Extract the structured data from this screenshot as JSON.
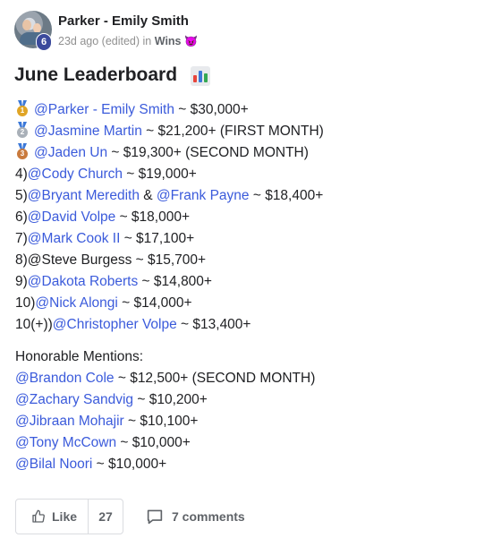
{
  "post": {
    "author": "Parker - Emily Smith",
    "level": "6",
    "time": "23d ago (edited)",
    "in_label": "in",
    "category": "Wins",
    "category_emoji": "😈",
    "title": "June Leaderboard",
    "title_emoji": "chart-icon"
  },
  "leaderboard": [
    {
      "prefix": "",
      "medal": "1",
      "names": [
        "@Parker - Emily Smith"
      ],
      "joiner": "",
      "suffix": " ~ $30,000+"
    },
    {
      "prefix": "",
      "medal": "2",
      "names": [
        "@Jasmine Martin"
      ],
      "joiner": "",
      "suffix": " ~ $21,200+ (FIRST MONTH)"
    },
    {
      "prefix": "",
      "medal": "3",
      "names": [
        "@Jaden Un"
      ],
      "joiner": "",
      "suffix": " ~ $19,300+ (SECOND MONTH)"
    },
    {
      "prefix": "4)",
      "medal": "",
      "names": [
        "@Cody Church"
      ],
      "joiner": "",
      "suffix": " ~ $19,000+"
    },
    {
      "prefix": "5)",
      "medal": "",
      "names": [
        "@Bryant Meredith",
        "@Frank Payne"
      ],
      "joiner": " & ",
      "suffix": " ~ $18,400+"
    },
    {
      "prefix": "6)",
      "medal": "",
      "names": [
        "@David Volpe"
      ],
      "joiner": "",
      "suffix": " ~ $18,000+"
    },
    {
      "prefix": "7)",
      "medal": "",
      "names": [
        "@Mark Cook II"
      ],
      "joiner": "",
      "suffix": " ~ $17,100+"
    },
    {
      "prefix": "8)@Steve Burgess",
      "medal": "",
      "names": [],
      "joiner": "",
      "suffix": " ~ $15,700+"
    },
    {
      "prefix": "9)",
      "medal": "",
      "names": [
        "@Dakota Roberts"
      ],
      "joiner": "",
      "suffix": " ~ $14,800+"
    },
    {
      "prefix": "10)",
      "medal": "",
      "names": [
        "@Nick Alongi"
      ],
      "joiner": "",
      "suffix": " ~ $14,000+"
    },
    {
      "prefix": "10(+))",
      "medal": "",
      "names": [
        "@Christopher Volpe"
      ],
      "joiner": "",
      "suffix": " ~ $13,400+"
    }
  ],
  "honorable": {
    "heading": "Honorable Mentions:",
    "items": [
      {
        "name": "@Brandon Cole",
        "suffix": " ~ $12,500+ (SECOND MONTH)"
      },
      {
        "name": "@Zachary Sandvig",
        "suffix": " ~ $10,200+"
      },
      {
        "name": "@Jibraan Mohajir",
        "suffix": " ~ $10,100+"
      },
      {
        "name": "@Tony McCown",
        "suffix": " ~ $10,000+"
      },
      {
        "name": "@Bilal Noori",
        "suffix": " ~ $10,000+"
      }
    ]
  },
  "footer": {
    "like_label": "Like",
    "like_count": "27",
    "comments_label": "7 comments"
  },
  "colors": {
    "mention": "#3b5bdb",
    "gold": "#e0a526",
    "silver": "#a9b0b8",
    "bronze": "#c97a3d"
  }
}
